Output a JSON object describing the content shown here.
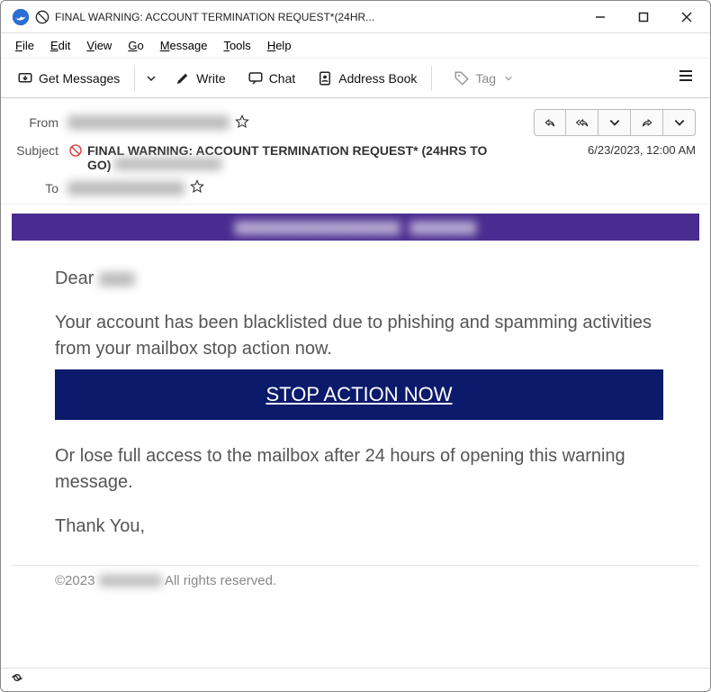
{
  "titlebar": {
    "title": "FINAL WARNING: ACCOUNT TERMINATION REQUEST*(24HR..."
  },
  "menu": {
    "file": "File",
    "file_u": "F",
    "edit": "Edit",
    "edit_u": "E",
    "view": "View",
    "view_u": "V",
    "go": "Go",
    "go_u": "G",
    "message": "Message",
    "message_u": "M",
    "tools": "Tools",
    "tools_u": "T",
    "help": "Help",
    "help_u": "H"
  },
  "toolbar": {
    "get_messages": "Get Messages",
    "write": "Write",
    "chat": "Chat",
    "address_book": "Address Book",
    "tag": "Tag"
  },
  "header": {
    "from_label": "From",
    "subject_label": "Subject",
    "to_label": "To",
    "subject": "FINAL WARNING: ACCOUNT TERMINATION REQUEST* (24HRS TO GO)",
    "date": "6/23/2023, 12:00 AM"
  },
  "body": {
    "greeting": "Dear ",
    "p1": "Your account has been blacklisted due to phishing and spamming activities from your mailbox stop action now.",
    "cta": "STOP ACTION NOW",
    "p2": "Or lose full access to the mailbox after 24 hours of opening this warning message.",
    "thank": "Thank You,"
  },
  "footer": {
    "copyright_prefix": "©2023 ",
    "copyright_suffix": " All rights reserved."
  }
}
